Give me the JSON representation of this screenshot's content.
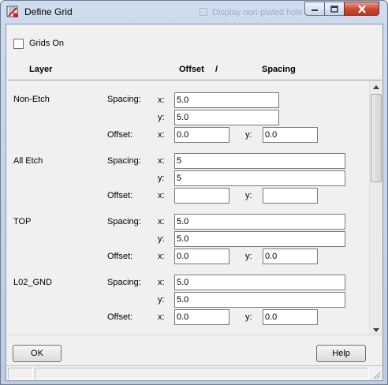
{
  "window": {
    "title": "Define Grid",
    "background_text": "Display non-plated hole",
    "icons": {
      "app": "define-grid-app-icon",
      "minimize": "minimize-icon",
      "maximize": "maximize-icon",
      "close": "close-icon"
    }
  },
  "grids_on": {
    "label": "Grids On",
    "checked": false
  },
  "headers": {
    "layer": "Layer",
    "offset": "Offset",
    "slash": "/",
    "spacing": "Spacing"
  },
  "labels": {
    "spacing": "Spacing:",
    "offset": "Offset:",
    "x": "x:",
    "y": "y:"
  },
  "layers": [
    {
      "name": "Non-Etch",
      "spacing_x": "5.0",
      "spacing_y": "5.0",
      "offset_x": "0.0",
      "offset_y": "0.0"
    },
    {
      "name": "All Etch",
      "spacing_x": "5",
      "spacing_y": "5",
      "offset_x": "",
      "offset_y": ""
    },
    {
      "name": "TOP",
      "spacing_x": "5.0",
      "spacing_y": "5.0",
      "offset_x": "0.0",
      "offset_y": "0.0"
    },
    {
      "name": "L02_GND",
      "spacing_x": "5.0",
      "spacing_y": "5.0",
      "offset_x": "0.0",
      "offset_y": "0.0"
    }
  ],
  "buttons": {
    "ok": "OK",
    "help": "Help"
  },
  "colors": {
    "title_bar": "#bccbe0",
    "close_button": "#c9472f",
    "dialog_face": "#f0f0f0"
  }
}
